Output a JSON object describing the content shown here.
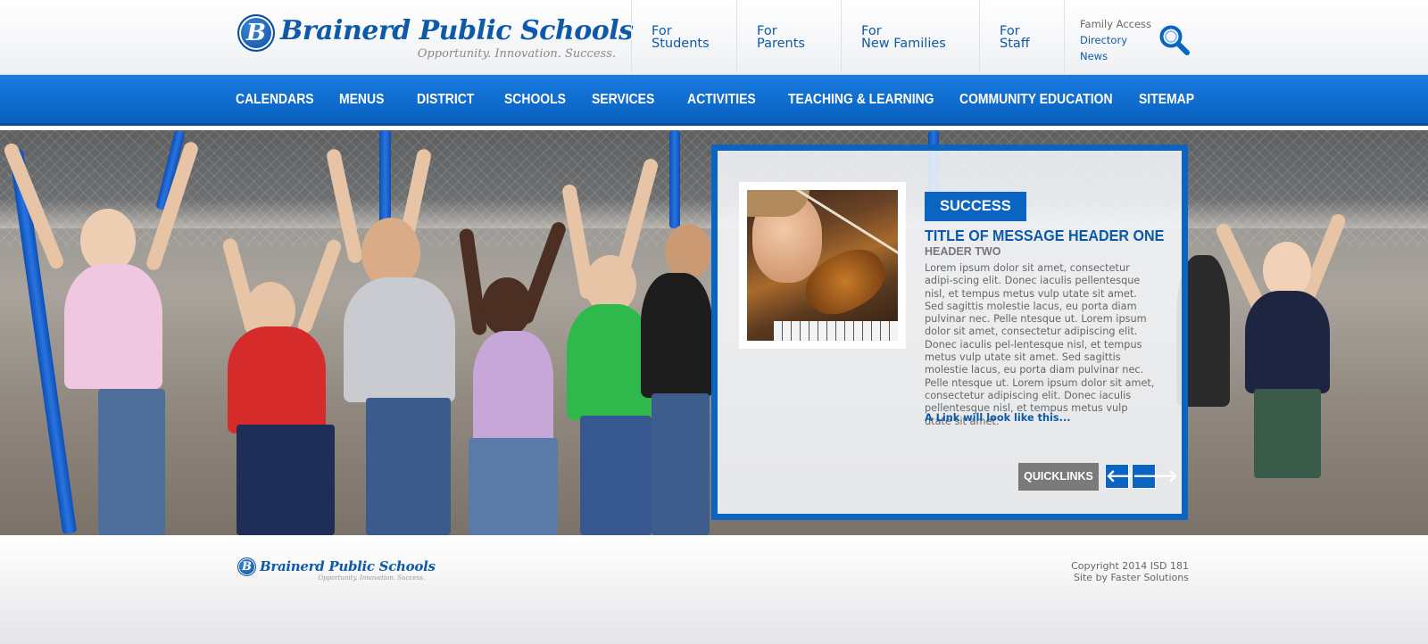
{
  "site": {
    "name": "Brainerd Public Schools",
    "tagline": "Opportunity. Innovation. Success.",
    "badge_letter": "B"
  },
  "audience_links": [
    {
      "line1": "For",
      "line2": "Students"
    },
    {
      "line1": "For",
      "line2": "Parents"
    },
    {
      "line1": "For",
      "line2": "New Families"
    },
    {
      "line1": "For",
      "line2": "Staff"
    }
  ],
  "utility_links": [
    "Family Access",
    "Directory",
    "News"
  ],
  "icons": {
    "search": "search-icon",
    "prev": "arrow-left-icon",
    "next": "arrow-right-icon"
  },
  "nav": [
    "CALENDARS",
    "MENUS",
    "DISTRICT",
    "SCHOOLS",
    "SERVICES",
    "ACTIVITIES",
    "TEACHING & LEARNING",
    "COMMUNITY EDUCATION",
    "SITEMAP"
  ],
  "feature": {
    "tag": "SUCCESS",
    "title": "TITLE OF MESSAGE HEADER ONE",
    "subtitle": "HEADER TWO",
    "body": "Lorem ipsum dolor sit amet, consectetur adipi-scing elit. Donec iaculis pellentesque nisl, et tempus metus vulp utate sit amet. Sed sagittis molestie lacus, eu porta diam pulvinar nec. Pelle ntesque ut. Lorem ipsum dolor sit amet, consectetur adipiscing elit. Donec iaculis pel-lentesque nisl, et tempus metus vulp utate sit amet. Sed sagittis molestie lacus, eu porta diam pulvinar nec. Pelle ntesque ut. Lorem ipsum dolor sit amet, consectetur adipiscing elit. Donec iaculis pellentesque nisl, et tempus metus vulp utate sit amet.",
    "link": "A Link will look like this...",
    "quicklinks": "QUICKLINKS",
    "prev_glyph": "🡐",
    "next_glyph": "🡒"
  },
  "footer": {
    "copyright": "Copyright 2014 ISD 181",
    "credit": "Site by Faster Solutions"
  },
  "colors": {
    "brand_blue": "#0b64c2",
    "nav_blue": "#1a7be0",
    "text_gray": "#666666"
  }
}
